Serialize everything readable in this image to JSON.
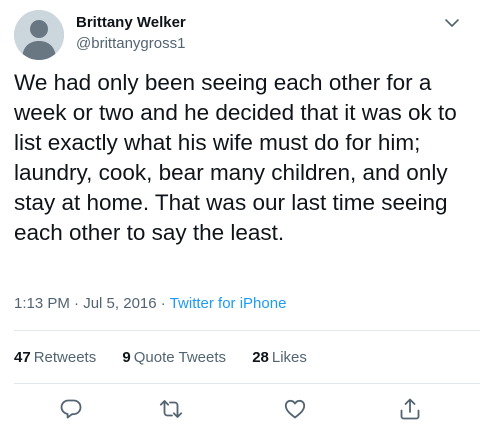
{
  "tweet": {
    "author": {
      "display_name": "Brittany Welker",
      "handle": "@brittanygross1"
    },
    "text": "We had only been seeing each other for a week or two and he decided that it was ok to list exactly what his wife must do for him; laundry, cook, bear many children, and only stay at home. That was our last time seeing each other to say the least.",
    "time": "1:13 PM",
    "separator": "·",
    "date": "Jul 5, 2016",
    "source": "Twitter for iPhone",
    "stats": {
      "retweets_count": "47",
      "retweets_label": "Retweets",
      "quotes_count": "9",
      "quotes_label": "Quote Tweets",
      "likes_count": "28",
      "likes_label": "Likes"
    }
  },
  "icons": {
    "avatar": "default-avatar-icon",
    "caret": "chevron-down-icon",
    "reply": "reply-icon",
    "retweet": "retweet-icon",
    "like": "heart-icon",
    "share": "share-icon"
  },
  "colors": {
    "text": "#0f1419",
    "secondary": "#536471",
    "accent": "#1d9bf0",
    "divider": "#e1e8ed",
    "avatar_bg": "#ccd6dd"
  }
}
